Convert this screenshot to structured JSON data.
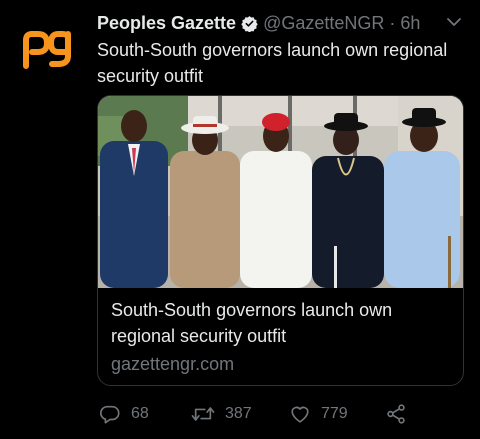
{
  "tweet": {
    "author": {
      "display_name": "Peoples Gazette",
      "handle": "@GazetteNGR",
      "separator": "·",
      "time": "6h",
      "avatar_icon": "peoples-gazette-logo",
      "avatar_color": "#f7941d",
      "verified": true
    },
    "text": "South-South governors launch own regional security outfit",
    "card": {
      "image_icon": "governors-group-photo",
      "title": "South-South governors launch own regional security outfit",
      "domain": "gazettengr.com"
    },
    "actions": {
      "replies": "68",
      "retweets": "387",
      "likes": "779"
    }
  },
  "colors": {
    "background": "#000000",
    "text_primary": "#e7e9ea",
    "text_secondary": "#71767b",
    "border": "#2f3336",
    "brand": "#f7941d"
  }
}
